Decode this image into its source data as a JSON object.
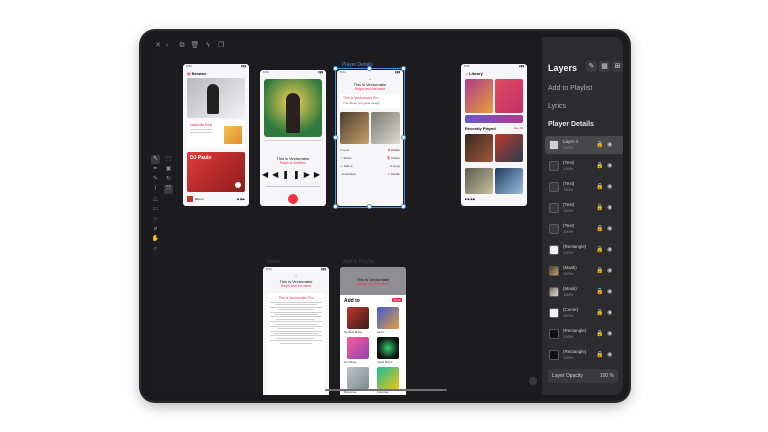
{
  "toolbar": {
    "close_icon": "✕",
    "chevron_icon": "‹",
    "duplicate_icon": "⧉",
    "trash_icon": "🗑",
    "flash_icon": "ϟ",
    "copy_icon": "❐",
    "text_icon": "A",
    "diamond_icon": "◇",
    "transform_icon": "⧩",
    "layers_icon": "▤",
    "export_icon": "⊙"
  },
  "artboards": {
    "browse": {
      "title": "Browse",
      "artist_card": "Nashville Best",
      "playlist": "DJ Paulo",
      "mini_player": "Bloom"
    },
    "player": {
      "song": "This is Vectornator",
      "artist": "Ralph & Sheldon"
    },
    "player_details": {
      "label": "Player Details",
      "song": "This is Vectornator",
      "artist": "Ralph and the band",
      "playlist": "This is Vectornator Pro",
      "playlist_sub": "The album you gotta design",
      "actions": [
        "Love",
        "Share",
        "Add to",
        "Download",
        "Dislike",
        "Delete",
        "Copy",
        "Shuffle"
      ]
    },
    "library": {
      "title": "Library",
      "section": "Recently Played",
      "see_all": "See All"
    },
    "lyrics": {
      "label": "Lyrics",
      "song": "This is Vectornator",
      "artist": "Ralph and the band",
      "playlist": "This is Vectornator Pro"
    },
    "add_to_playlist": {
      "label": "Add to Playlist",
      "song": "This is Vectornator",
      "artist": "Ralph and the band",
      "heading": "Add to",
      "button": "New",
      "items": [
        "My Best Mixes",
        "Liked",
        "Pro Mixes",
        "Apple Mixes",
        "Ringtones",
        "Favorites"
      ]
    }
  },
  "panel": {
    "title": "Layers",
    "sections": [
      "Add to Playlist",
      "Lyrics",
      "Player Details"
    ],
    "layers": [
      {
        "name": "Layer 4",
        "opacity": "100%"
      },
      {
        "name": "(Text)",
        "opacity": "100%"
      },
      {
        "name": "(Text)",
        "opacity": "100%"
      },
      {
        "name": "(Text)",
        "opacity": "100%"
      },
      {
        "name": "(Text)",
        "opacity": "100%"
      },
      {
        "name": "(Rectangle)",
        "opacity": "100%"
      },
      {
        "name": "(Mask)",
        "opacity": "100%"
      },
      {
        "name": "(Mask)",
        "opacity": "100%"
      },
      {
        "name": "(Curve)",
        "opacity": "100%"
      },
      {
        "name": "(Rectangle)",
        "opacity": "100%"
      },
      {
        "name": "(Rectangle)",
        "opacity": "100%"
      }
    ],
    "opacity_label": "Layer Opacity",
    "opacity_value": "100 %"
  },
  "colors": {
    "accent": "#fa2d48",
    "selection": "#4a90d9",
    "panel": "#2c2c2e",
    "canvas": "#1c1c1e"
  }
}
